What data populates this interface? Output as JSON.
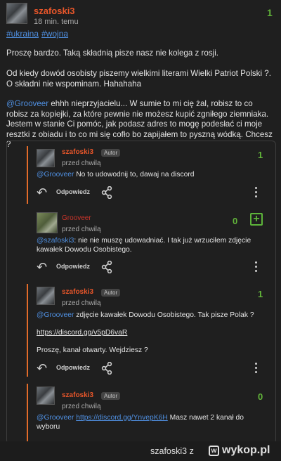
{
  "post": {
    "username": "szafoski3",
    "time": "18 min. temu",
    "votes": "1",
    "tags": [
      "#ukraina",
      "#wojna"
    ],
    "paragraphs": [
      "Proszę bardzo. Taką składnią pisze nasz nie kolega z rosji.",
      "Od kiedy dowód osobisty piszemy wielkimi literami Wielki Patriot Polski ?. O składni nie wspominam. Hahahaha"
    ],
    "p3_mention": "@Grooveer",
    "p3_text": " ehhh nieprzyjacielu... W sumie to mi cię żal, robisz to co robisz za kopiejki, za które pewnie nie możesz kupić zgniłego ziemniaka. Jestem w stanie Ci pomóc, jak podasz adres to mogę podesłać ci moje resztki z obiadu i to co mi się cofło bo zapijałem to pyszną wódką. Chcesz ?"
  },
  "actions": {
    "reply_label": "Odpowiedz",
    "reply_icon": "reply-arrow-icon",
    "share_icon": "share-icon",
    "more_icon": "kebab-icon"
  },
  "comments": [
    {
      "username": "szafoski3",
      "badge": "Autor",
      "time": "przed chwilą",
      "votes": "1",
      "mention": "@Grooveer",
      "text": " No to udowodnij to, dawaj na discord"
    },
    {
      "username": "Grooveer",
      "time": "przed chwilą",
      "votes": "0",
      "plus": "+",
      "mention": "@szafoski3",
      "text": ": nie nie muszę udowadniać. I tak już wrzuciłem zdjęcie kawałek Dowodu Osobistego."
    },
    {
      "username": "szafoski3",
      "badge": "Autor",
      "time": "przed chwilą",
      "votes": "1",
      "mention": "@Grooveer",
      "text": " zdjęcie kawałek Dowodu Osobistego. Tak pisze Polak ?",
      "link": "https://discord.gg/v5pD6vaR",
      "text2": "Proszę, kanał otwarty. Wejdziesz ?"
    },
    {
      "username": "szafoski3",
      "badge": "Autor",
      "time": "przed chwilą",
      "votes": "0",
      "mention": "@Grooveer",
      "link": "https://discord.gg/YnvepK6H",
      "text": " Masz nawet 2 kanał do wyboru"
    }
  ],
  "footer": {
    "user": "szafoski3 z",
    "site": "wykop.pl",
    "logo_letter": "w"
  },
  "colors": {
    "accent": "#e8562a",
    "link": "#4f8fe0",
    "upvote": "#5db53a",
    "author_bar": "#e26b2a"
  }
}
